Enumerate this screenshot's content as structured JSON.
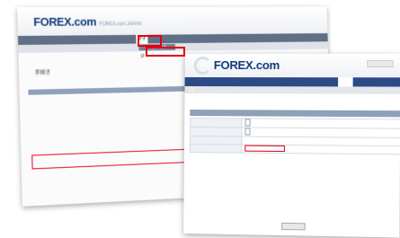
{
  "back": {
    "logo": "FOREX",
    "logo_suffix": ".com",
    "logo_sub": "FOREX.com JAPAN",
    "header_links": "",
    "nav_items": "",
    "nav_mypage": "マイページ",
    "tabs": "",
    "subtab": "各種手続き",
    "page_title": "手続き",
    "page_desc": "",
    "blocks": [
      {
        "title": "",
        "desc": ""
      },
      {
        "title": "",
        "desc": ""
      },
      {
        "title": "",
        "desc": ""
      }
    ],
    "highlight_title": "",
    "highlight_desc": ""
  },
  "front": {
    "logo": "FOREX",
    "logo_suffix": ".com",
    "logo_sub": "",
    "nav_items": "",
    "nav_mypage": "",
    "tabs_active": "",
    "tabs_rest": "",
    "page_title": "",
    "rows": [
      {
        "label": "",
        "value": "",
        "kind": "select"
      },
      {
        "label": "",
        "value": "",
        "kind": "select"
      },
      {
        "label": "",
        "value": "",
        "kind": "text"
      },
      {
        "label": "",
        "value": "",
        "kind": "email"
      }
    ],
    "notes": [
      "",
      "",
      "",
      "",
      "",
      ""
    ]
  },
  "colors": {
    "highlight_red": "#e60012",
    "brand_navy": "#123a7a",
    "nav_blue": "#2c4a86"
  }
}
